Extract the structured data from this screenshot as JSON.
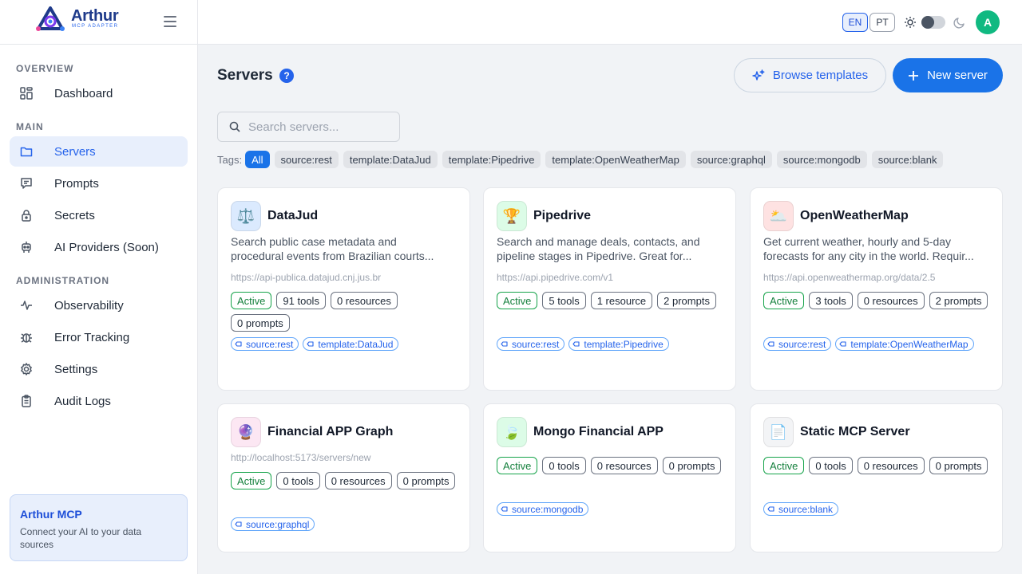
{
  "brand": {
    "name": "Arthur",
    "subtitle": "MCP ADAPTER"
  },
  "sidebar": {
    "sections": {
      "overview": "OVERVIEW",
      "main": "MAIN",
      "administration": "ADMINISTRATION"
    },
    "items": [
      {
        "label": "Dashboard",
        "icon": "dashboard-icon"
      },
      {
        "label": "Servers",
        "icon": "folder-icon",
        "active": true
      },
      {
        "label": "Prompts",
        "icon": "message-icon"
      },
      {
        "label": "Secrets",
        "icon": "lock-icon"
      },
      {
        "label": "AI Providers (Soon)",
        "icon": "robot-icon"
      },
      {
        "label": "Observability",
        "icon": "activity-icon"
      },
      {
        "label": "Error Tracking",
        "icon": "bug-icon"
      },
      {
        "label": "Settings",
        "icon": "gear-icon"
      },
      {
        "label": "Audit Logs",
        "icon": "clipboard-icon"
      }
    ],
    "promo": {
      "title": "Arthur MCP",
      "text": "Connect your AI to your data sources"
    }
  },
  "header": {
    "languages": [
      "EN",
      "PT"
    ],
    "active_language": "EN",
    "avatar_initial": "A"
  },
  "main": {
    "title": "Servers",
    "browse_button": "Browse templates",
    "new_button": "New server",
    "search_placeholder": "Search servers...",
    "tags_label": "Tags:",
    "tags": [
      "All",
      "source:rest",
      "template:DataJud",
      "template:Pipedrive",
      "template:OpenWeatherMap",
      "source:graphql",
      "source:mongodb",
      "source:blank"
    ]
  },
  "cards": [
    {
      "icon": "scales-icon",
      "glyph": "⚖️",
      "icon_bg": "#dbeafe",
      "title": "DataJud",
      "desc": [
        "Search public case metadata and",
        "procedural events from Brazilian courts..."
      ],
      "url": "https://api-publica.datajud.cnj.jus.br",
      "status": "Active",
      "tools": "91 tools",
      "resources": "0 resources",
      "prompts": "0 prompts",
      "tags": [
        "source:rest",
        "template:DataJud"
      ]
    },
    {
      "icon": "trophy-icon",
      "glyph": "🏆",
      "icon_bg": "#dcfce7",
      "title": "Pipedrive",
      "desc": [
        "Search and manage deals, contacts, and",
        "pipeline stages in Pipedrive. Great for..."
      ],
      "url": "https://api.pipedrive.com/v1",
      "status": "Active",
      "tools": "5 tools",
      "resources": "1 resource",
      "prompts": "2 prompts",
      "tags": [
        "source:rest",
        "template:Pipedrive"
      ]
    },
    {
      "icon": "weather-icon",
      "glyph": "🌥️",
      "icon_bg": "#fee2e2",
      "title": "OpenWeatherMap",
      "desc": [
        "Get current weather, hourly and 5-day",
        "forecasts for any city in the world. Requir..."
      ],
      "url": "https://api.openweathermap.org/data/2.5",
      "status": "Active",
      "tools": "3 tools",
      "resources": "0 resources",
      "prompts": "2 prompts",
      "tags": [
        "source:rest",
        "template:OpenWeatherMap"
      ]
    },
    {
      "icon": "crystal-ball-icon",
      "glyph": "🔮",
      "icon_bg": "#fce7f3",
      "title": "Financial APP Graph",
      "desc": [],
      "url": "http://localhost:5173/servers/new",
      "status": "Active",
      "tools": "0 tools",
      "resources": "0 resources",
      "prompts": "0 prompts",
      "tags": [
        "source:graphql"
      ]
    },
    {
      "icon": "leaf-icon",
      "glyph": "🍃",
      "icon_bg": "#dcfce7",
      "title": "Mongo Financial APP",
      "desc": [],
      "url": "",
      "status": "Active",
      "tools": "0 tools",
      "resources": "0 resources",
      "prompts": "0 prompts",
      "tags": [
        "source:mongodb"
      ]
    },
    {
      "icon": "document-icon",
      "glyph": "📄",
      "icon_bg": "#f3f4f6",
      "title": "Static MCP Server",
      "desc": [],
      "url": "",
      "status": "Active",
      "tools": "0 tools",
      "resources": "0 resources",
      "prompts": "0 prompts",
      "tags": [
        "source:blank"
      ]
    }
  ]
}
